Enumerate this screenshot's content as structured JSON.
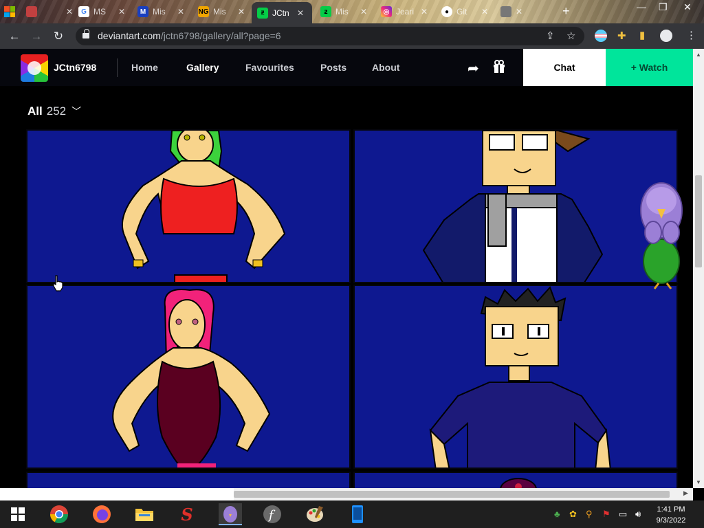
{
  "browser": {
    "tabs": [
      {
        "label": "",
        "icon": "photo-tab-icon",
        "color": "#c24040"
      },
      {
        "label": "MS",
        "icon": "google-icon",
        "color": "#ffffff"
      },
      {
        "label": "Mis",
        "icon": "mission-icon",
        "color": "#1a3fbf"
      },
      {
        "label": "Mis",
        "icon": "newgrounds-icon",
        "color": "#f0a500"
      },
      {
        "label": "JCtn",
        "icon": "deviantart-icon",
        "color": "#05cc47",
        "active": true
      },
      {
        "label": "Mis",
        "icon": "deviantart-icon",
        "color": "#05cc47"
      },
      {
        "label": "Jeari",
        "icon": "instagram-icon",
        "color": "#d6249f"
      },
      {
        "label": "Git",
        "icon": "github-icon",
        "color": "#ffffff"
      },
      {
        "label": "",
        "icon": "tab-icon",
        "color": "#888888"
      }
    ],
    "url_domain": "deviantart.com",
    "url_path": "/jctn6798/gallery/all?page=6"
  },
  "header": {
    "username": "JCtn6798",
    "nav": [
      "Home",
      "Gallery",
      "Favourites",
      "Posts",
      "About"
    ],
    "active_nav": "Gallery",
    "chat_label": "Chat",
    "watch_label": "+ Watch",
    "watch_color": "#00e59b"
  },
  "gallery": {
    "filter_label": "All",
    "count": "252"
  },
  "taskbar": {
    "time": "1:41 PM",
    "date": "9/3/2022"
  }
}
